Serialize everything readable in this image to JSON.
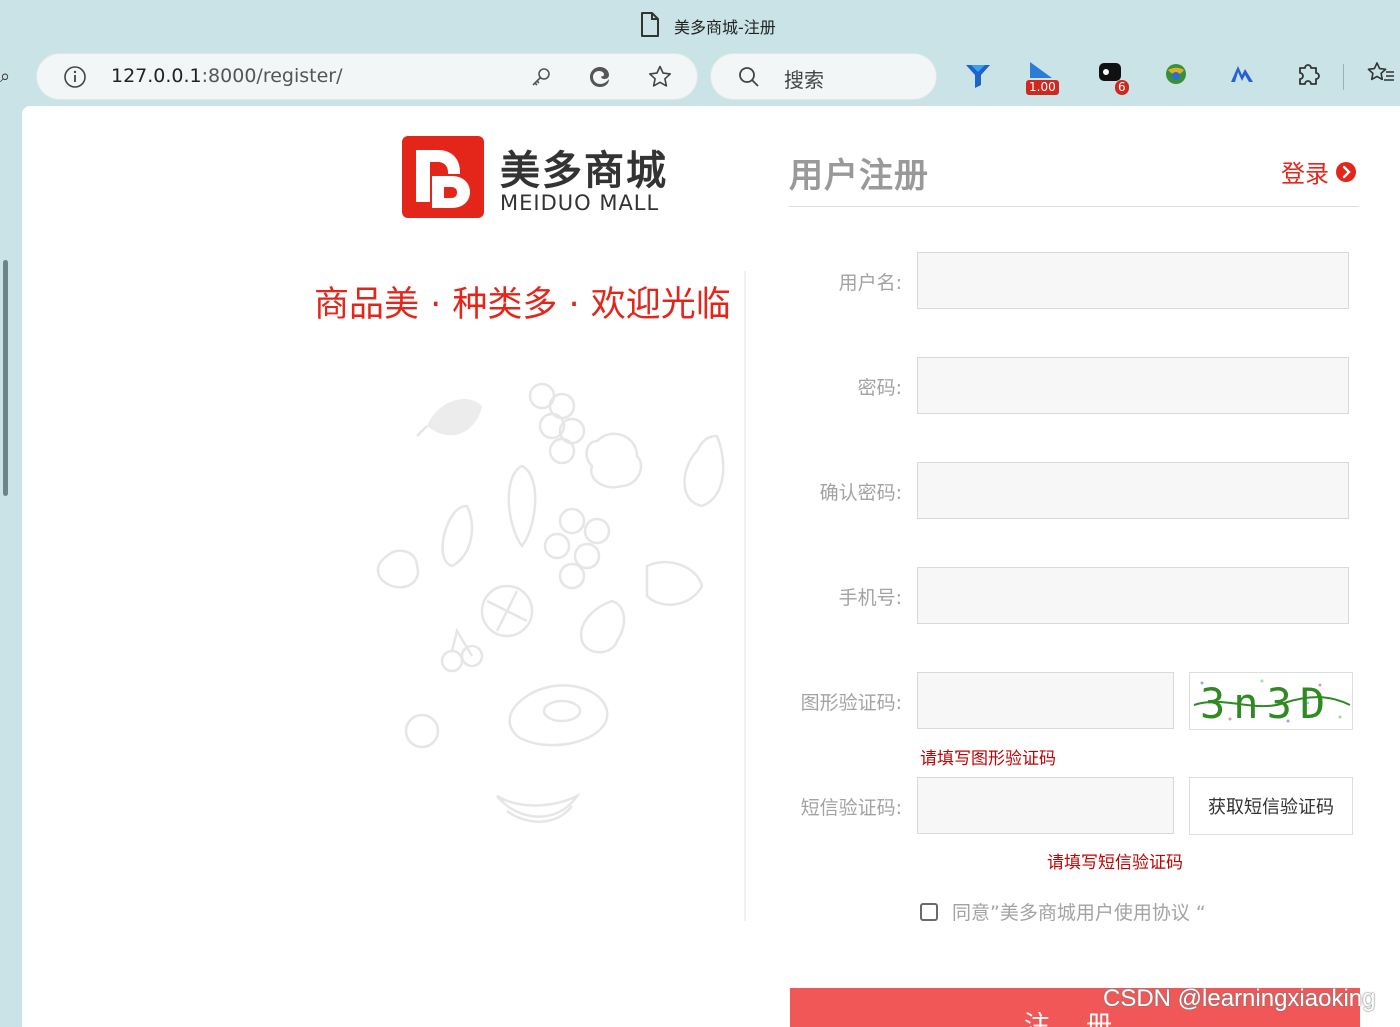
{
  "browser": {
    "tab_title": "美多商城-注册",
    "url_host": "127.0.0.1",
    "url_rest": ":8000/register/",
    "search_label": "搜索",
    "extensions": [
      {
        "name": "funnel-extension-icon",
        "badge": ""
      },
      {
        "name": "speed-extension-icon",
        "badge": "1.00"
      },
      {
        "name": "notification-extension-icon",
        "badge": "6"
      },
      {
        "name": "globe-extension-icon",
        "badge": ""
      },
      {
        "name": "translate-extension-icon",
        "badge": ""
      },
      {
        "name": "puzzle-extensions-icon",
        "badge": ""
      },
      {
        "name": "favorites-icon",
        "badge": ""
      }
    ]
  },
  "brand": {
    "logo_cn": "美多商城",
    "logo_en": "MEIDUO MALL",
    "slogan": "商品美 · 种类多 · 欢迎光临",
    "accent_color": "#e4261a"
  },
  "register": {
    "title": "用户注册",
    "login_label": "登录",
    "fields": {
      "username_label": "用户名:",
      "password_label": "密码:",
      "confirm_password_label": "确认密码:",
      "mobile_label": "手机号:",
      "image_code_label": "图形验证码:",
      "sms_code_label": "短信验证码:"
    },
    "captcha_text": "3n3D",
    "image_code_error": "请填写图形验证码",
    "sms_button_label": "获取短信验证码",
    "sms_code_error": "请填写短信验证码",
    "agreement_text": "同意”美多商城用户使用协议 “",
    "submit_label": "注 册",
    "submit_color": "#f25757"
  },
  "watermark": "CSDN @learningxiaoking"
}
